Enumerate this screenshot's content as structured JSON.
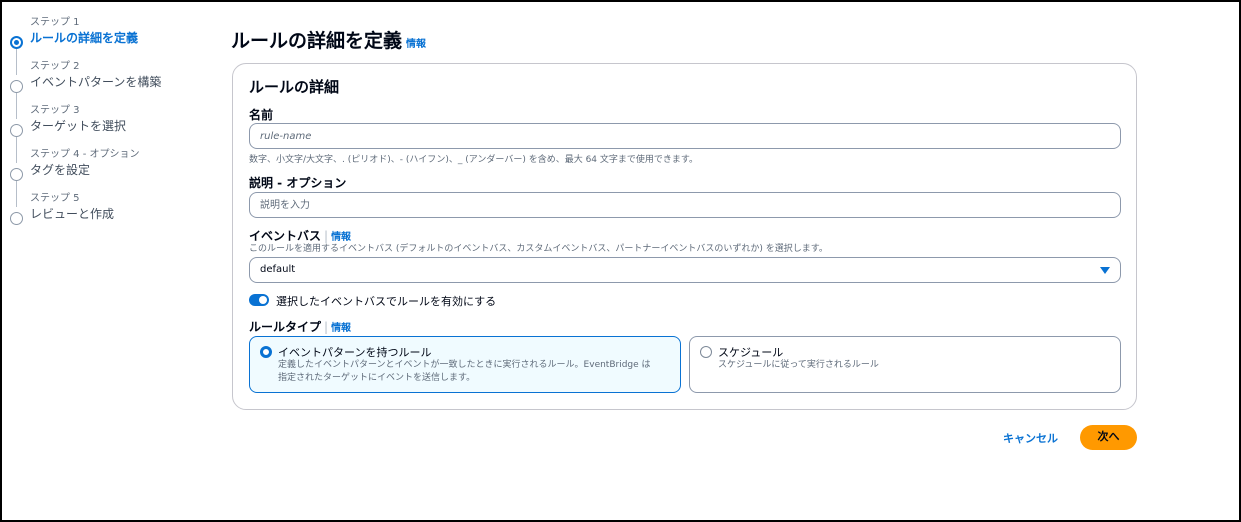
{
  "steps": [
    {
      "num": "ステップ 1",
      "label": "ルールの詳細を定義",
      "active": true
    },
    {
      "num": "ステップ 2",
      "label": "イベントパターンを構築"
    },
    {
      "num": "ステップ 3",
      "label": "ターゲットを選択"
    },
    {
      "num": "ステップ 4 - オプション",
      "label": "タグを設定"
    },
    {
      "num": "ステップ 5",
      "label": "レビューと作成"
    }
  ],
  "header": {
    "title": "ルールの詳細を定義",
    "info": "情報"
  },
  "panel": {
    "title": "ルールの詳細",
    "name": {
      "label": "名前",
      "placeholder": "rule-name",
      "hint": "数字、小文字/大文字、. (ピリオド)、- (ハイフン)、_ (アンダーバー) を含め、最大 64 文字まで使用できます。"
    },
    "description": {
      "label": "説明 - オプション",
      "placeholder": "説明を入力"
    },
    "event_bus": {
      "label": "イベントバス",
      "info": "情報",
      "hint": "このルールを適用するイベントバス (デフォルトのイベントバス、カスタムイベントバス、パートナーイベントバスのいずれか) を選択します。",
      "value": "default"
    },
    "toggle_label": "選択したイベントバスでルールを有効にする",
    "rule_type": {
      "label": "ルールタイプ",
      "info": "情報",
      "options": [
        {
          "title": "イベントパターンを持つルール",
          "desc": "定義したイベントパターンとイベントが一致したときに実行されるルール。EventBridge は指定されたターゲットにイベントを送信します。",
          "selected": true
        },
        {
          "title": "スケジュール",
          "desc": "スケジュールに従って実行されるルール"
        }
      ]
    }
  },
  "footer": {
    "cancel": "キャンセル",
    "next": "次へ"
  },
  "colors": {
    "accent": "#0972d3",
    "primary_button": "#ff9900"
  }
}
